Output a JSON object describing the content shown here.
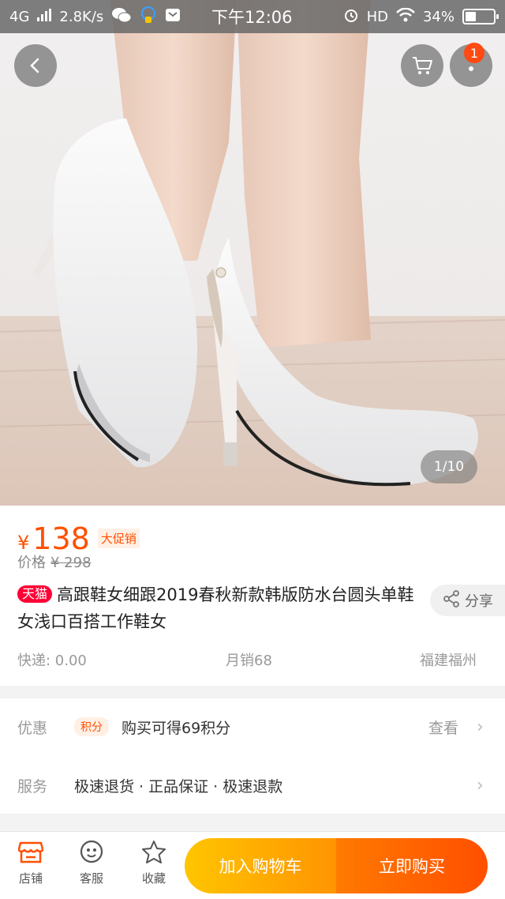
{
  "status_bar": {
    "network": "4G",
    "speed": "2.8K/s",
    "time": "下午12:06",
    "hd": "HD",
    "battery": "34%",
    "battery_level": 0.34
  },
  "hero": {
    "counter": "1/10",
    "cart_badge": "1"
  },
  "product": {
    "currency": "¥",
    "price": "138",
    "promo_tag": "大促销",
    "original_label": "价格",
    "original_price": "¥ 298",
    "store_tag": "天猫",
    "title": "高跟鞋女细跟2019春秋新款韩版防水台圆头单鞋女浅口百搭工作鞋女",
    "share_label": "分享",
    "shipping": "快递: 0.00",
    "monthly_sales": "月销68",
    "location": "福建福州"
  },
  "promotions": {
    "discount_label": "优惠",
    "points_tag": "积分",
    "points_text": "购买可得69积分",
    "view_label": "查看",
    "service_label": "服务",
    "service_text": "极速退货 · 正品保证 · 极速退款"
  },
  "bottom_bar": {
    "store": "店铺",
    "service": "客服",
    "favorite": "收藏",
    "add_to_cart": "加入购物车",
    "buy_now": "立即购买"
  },
  "colors": {
    "accent": "#ff5000",
    "tmall": "#ff0036",
    "cart_gradient_start": "#ffc500",
    "buy_gradient_end": "#ff4f00"
  }
}
